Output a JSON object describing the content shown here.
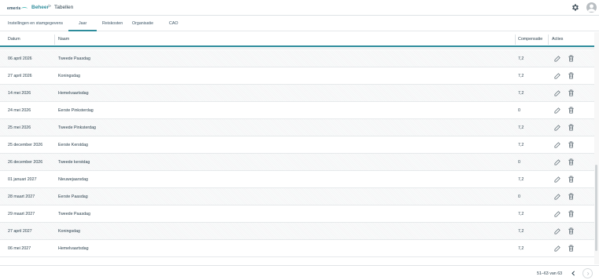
{
  "app": {
    "logo_text": "emeris",
    "breadcrumb": {
      "parent": "Beheer",
      "separator": ">",
      "current": "Tabellen"
    },
    "icons": {
      "settings": "gear-icon",
      "user": "avatar-icon"
    }
  },
  "tabs": [
    {
      "label": "Instellingen en stamgegevens"
    },
    {
      "label": "Jaar",
      "active": true
    },
    {
      "label": "Reiskosten"
    },
    {
      "label": "Organisatie"
    },
    {
      "label": "CAO"
    }
  ],
  "table": {
    "columns": {
      "date": "Datum",
      "name": "Naam",
      "compensation": "Compensatie",
      "actions": "Acties"
    },
    "rows": [
      {
        "date": "06 april 2026",
        "name": "Tweede Paasdag",
        "compensation": "7,2"
      },
      {
        "date": "27 april 2026",
        "name": "Koningsdag",
        "compensation": "7,2"
      },
      {
        "date": "14 mei 2026",
        "name": "Hemelvaartsdag",
        "compensation": "7,2"
      },
      {
        "date": "24 mei 2026",
        "name": "Eerste Pinksterdag",
        "compensation": "0"
      },
      {
        "date": "25 mei 2026",
        "name": "Tweede Pinksterdag",
        "compensation": "7,2"
      },
      {
        "date": "25 december 2026",
        "name": "Eerste Kerstdag",
        "compensation": "7,2"
      },
      {
        "date": "26 december 2026",
        "name": "Tweede kerstdag",
        "compensation": "0"
      },
      {
        "date": "01 januari 2027",
        "name": "Nieuwejaarsdag",
        "compensation": "7,2"
      },
      {
        "date": "28 maart 2027",
        "name": "Eerste Paasdag",
        "compensation": "0"
      },
      {
        "date": "29 maart 2027",
        "name": "Tweede Paasdag",
        "compensation": "7,2"
      },
      {
        "date": "27 april 2027",
        "name": "Koningsdag",
        "compensation": "7,2"
      },
      {
        "date": "06 mei 2027",
        "name": "Hemelvaartsdag",
        "compensation": "7,2"
      }
    ],
    "row_action_icons": [
      "edit-icon",
      "delete-icon"
    ]
  },
  "pagination": {
    "range": "51–63 van 63",
    "prev_icon": "chevron-left-icon",
    "next_icon": "chevron-right-icon"
  },
  "colors": {
    "accent": "#2f8d9c",
    "text": "#2a3f4c"
  }
}
